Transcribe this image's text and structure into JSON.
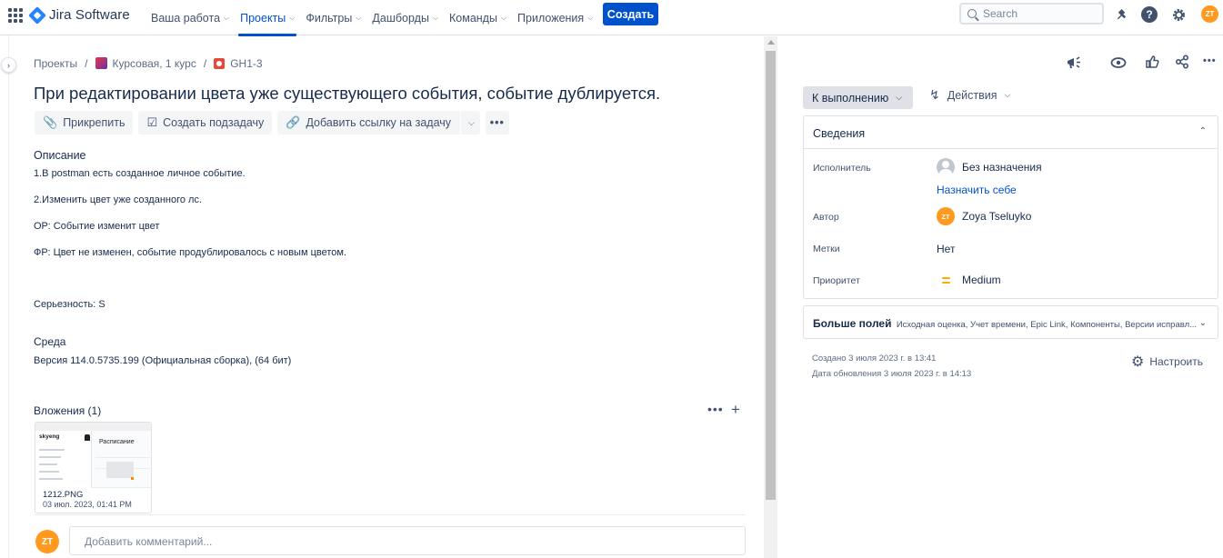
{
  "topnav": {
    "logo": "Jira Software",
    "items": [
      {
        "label": "Ваша работа",
        "active": false
      },
      {
        "label": "Проекты",
        "active": true
      },
      {
        "label": "Фильтры",
        "active": false
      },
      {
        "label": "Дашборды",
        "active": false
      },
      {
        "label": "Команды",
        "active": false
      },
      {
        "label": "Приложения",
        "active": false
      }
    ],
    "create_label": "Создать",
    "search_placeholder": "Search",
    "avatar_initials": "ZT"
  },
  "breadcrumb": {
    "root": "Проекты",
    "project": "Курсовая, 1 курс",
    "issue_key": "GH1-3"
  },
  "issue": {
    "title": "При редактировании цвета уже существующего события, событие дублируется.",
    "actions": {
      "attach": "Прикрепить",
      "subtask": "Создать подзадачу",
      "link": "Добавить ссылку на задачу"
    },
    "description_label": "Описание",
    "description_lines": [
      "1.В postman есть созданное личное событие.",
      "2.Изменить цвет уже созданного лс.",
      "ОР: Событие изменит цвет",
      "ФР: Цвет не изменен, событие продублировалось с новым цветом."
    ],
    "severity": "Серьезность: S",
    "env_label": "Среда",
    "env_value": "Версия 114.0.5735.199 (Официальная сборка), (64 бит)"
  },
  "attachments": {
    "label": "Вложения (1)",
    "items": [
      {
        "name": "1212.PNG",
        "date": "03 июл. 2023, 01:41 PM",
        "thumb_brand": "skyeng",
        "thumb_heading": "Расписание"
      }
    ]
  },
  "comment": {
    "avatar_initials": "ZT",
    "placeholder": "Добавить комментарий..."
  },
  "side": {
    "status": "К выполнению",
    "actions_label": "Действия",
    "details_title": "Сведения",
    "assignee_label": "Исполнитель",
    "assignee_value": "Без назначения",
    "assign_self": "Назначить себе",
    "author_label": "Автор",
    "author_initials": "ZT",
    "author_value": "Zoya Tseluyko",
    "labels_label": "Метки",
    "labels_value": "Нет",
    "priority_label": "Приоритет",
    "priority_value": "Medium",
    "more_fields_title": "Больше полей",
    "more_fields_list": "Исходная оценка, Учет времени, Epic Link, Компоненты, Версии исправл...",
    "created": "Создано 3 июля 2023 г. в 13:41",
    "updated": "Дата обновления 3 июля 2023 г. в 14:13",
    "configure": "Настроить"
  },
  "colors": {
    "brand": "#0052cc",
    "avatar": "#ff991f",
    "priority_medium": "#ffab00"
  }
}
